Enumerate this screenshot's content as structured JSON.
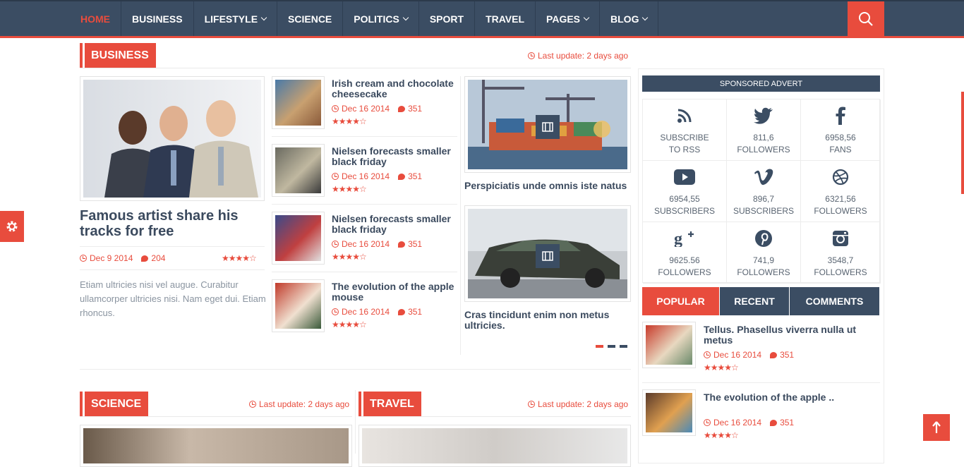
{
  "nav": {
    "items": [
      {
        "label": "HOME",
        "dropdown": false,
        "active": true
      },
      {
        "label": "BUSINESS",
        "dropdown": false
      },
      {
        "label": "LIFESTYLE",
        "dropdown": true
      },
      {
        "label": "SCIENCE",
        "dropdown": false
      },
      {
        "label": "POLITICS",
        "dropdown": true
      },
      {
        "label": "SPORT",
        "dropdown": false
      },
      {
        "label": "TRAVEL",
        "dropdown": false
      },
      {
        "label": "PAGES",
        "dropdown": true
      },
      {
        "label": "BLOG",
        "dropdown": true
      }
    ],
    "search_icon": "search-icon"
  },
  "business": {
    "title": "BUSINESS",
    "last_update": "Last update: 2 days ago",
    "featured": {
      "title": "Famous artist share his tracks for free",
      "date": "Dec 9 2014",
      "comments": "204",
      "stars": "★★★★☆",
      "excerpt": "Etiam ultricies nisi vel augue. Curabitur ullamcorper ultricies nisi. Nam eget dui. Etiam rhoncus."
    },
    "list": [
      {
        "title": "Irish cream and chocolate cheesecake",
        "date": "Dec 16 2014",
        "comments": "351",
        "stars": "★★★★☆"
      },
      {
        "title": "Nielsen forecasts smaller black friday",
        "date": "Dec 16 2014",
        "comments": "351",
        "stars": "★★★★☆"
      },
      {
        "title": "Nielsen forecasts smaller black friday",
        "date": "Dec 16 2014",
        "comments": "351",
        "stars": "★★★★☆"
      },
      {
        "title": "The evolution of the apple mouse",
        "date": "Dec 16 2014",
        "comments": "351",
        "stars": "★★★★☆"
      }
    ],
    "videos": [
      {
        "title": "Perspiciatis unde omnis iste natus"
      },
      {
        "title": "Cras tincidunt enim non metus ultricies."
      }
    ]
  },
  "science": {
    "title": "SCIENCE",
    "last_update": "Last update: 2 days ago"
  },
  "travel": {
    "title": "TRAVEL",
    "last_update": "Last update: 2 days ago"
  },
  "sidebar": {
    "sponsored": "SPONSORED ADVERT",
    "social": [
      {
        "icon": "rss-icon",
        "num": "SUBSCRIBE",
        "label": "TO RSS"
      },
      {
        "icon": "twitter-icon",
        "num": "811,6",
        "label": "FOLLOWERS"
      },
      {
        "icon": "facebook-icon",
        "num": "6958,56",
        "label": "FANS"
      },
      {
        "icon": "youtube-icon",
        "num": "6954,55",
        "label": "SUBSCRIBERS"
      },
      {
        "icon": "vimeo-icon",
        "num": "896,7",
        "label": "SUBSCRIBERS"
      },
      {
        "icon": "dribbble-icon",
        "num": "6321,56",
        "label": "FOLLOWERS"
      },
      {
        "icon": "google-plus-icon",
        "num": "9625.56",
        "label": "FOLLOWERS"
      },
      {
        "icon": "pinterest-icon",
        "num": "741,9",
        "label": "FOLLOWERS"
      },
      {
        "icon": "instagram-icon",
        "num": "3548,7",
        "label": "FOLLOWERS"
      }
    ],
    "tabs": [
      {
        "label": "POPULAR",
        "active": true
      },
      {
        "label": "RECENT",
        "active": false
      },
      {
        "label": "COMMENTS",
        "active": false
      }
    ],
    "popular": [
      {
        "title": "Tellus. Phasellus viverra nulla ut metus",
        "date": "Dec 16 2014",
        "comments": "351",
        "stars": "★★★★☆"
      },
      {
        "title": "The evolution of the apple ..",
        "date": "Dec 16 2014",
        "comments": "351",
        "stars": "★★★★☆"
      }
    ]
  },
  "colors": {
    "accent": "#e84c3d",
    "navy": "#3b4d63"
  }
}
